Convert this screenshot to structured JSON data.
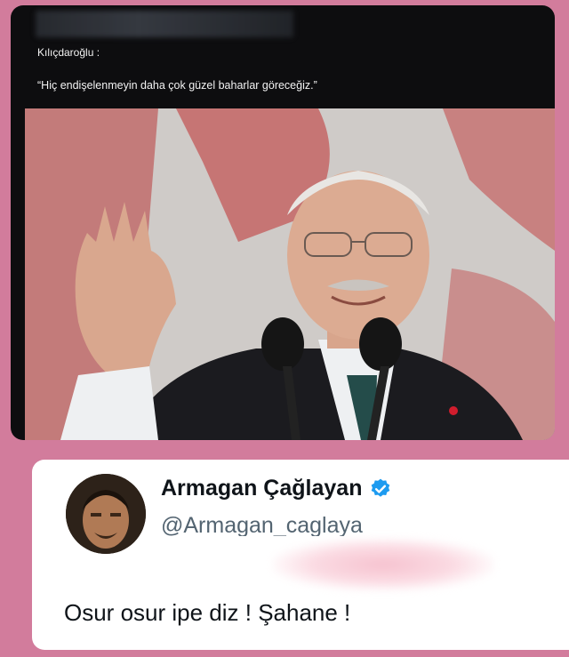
{
  "post": {
    "author_label": "Kılıçdaroğlu :",
    "quote": "“Hiç endişelenmeyin daha çok güzel baharlar göreceğiz.”"
  },
  "tweet": {
    "display_name": "Armagan Çağlayan",
    "handle": "@Armagan_caglaya",
    "text": "Osur osur ipe diz ! Şahane !",
    "verified": true
  },
  "colors": {
    "page_background": "#d27c9c",
    "dark_card": "#0d0d0f",
    "verified_blue": "#1d9bf0",
    "handle_gray": "#536471"
  },
  "icons": {
    "verified": "verified-badge-icon"
  }
}
